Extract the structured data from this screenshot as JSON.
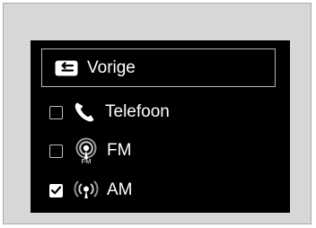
{
  "menu": {
    "back_label": "Vorige",
    "items": [
      {
        "label": "Telefoon",
        "icon": "phone-icon",
        "checked": false
      },
      {
        "label": "FM",
        "icon": "fm-radio-icon",
        "icon_text": "FM",
        "checked": false
      },
      {
        "label": "AM",
        "icon": "am-radio-icon",
        "checked": true
      }
    ]
  },
  "colors": {
    "frame": "#d7d7d7",
    "screen": "#000000",
    "text": "#ffffff",
    "border": "#b9b9b9"
  }
}
